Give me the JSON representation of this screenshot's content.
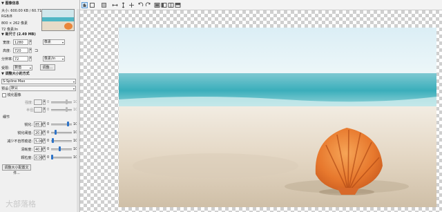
{
  "info": {
    "section_title": "图像信息",
    "size_line": "大小: 600.00 KB / 60.71 KB",
    "color_mode": "RGB/8",
    "dimensions": "800 × 262 像素",
    "resolution_line": "72 像素/in"
  },
  "new_size": {
    "section_title": "新尺寸 (2.49 MB)",
    "width_label": "宽度:",
    "width_value": "1280",
    "height_label": "高度:",
    "height_value": "720",
    "unit": "像素",
    "res_label": "分辨率:",
    "res_value": "72",
    "res_unit": "像素/in",
    "fit_label": "受限:",
    "fit_value": "数值",
    "adjust_button": "调整..."
  },
  "resample": {
    "section_title": "调整大小的方式",
    "method": "S-Spline Max",
    "preset_label": "预设:",
    "preset_value": "默认"
  },
  "sharpen": {
    "checkbox_label": "锐化图像",
    "strength_label": "强度:",
    "strength_value": "0",
    "radius_label": "半径:",
    "radius_value": "0",
    "max": "100"
  },
  "details": {
    "section_title": "细节",
    "rows": [
      {
        "label": "锐化:",
        "value": "85.00",
        "min": "0",
        "max": "100",
        "fraction": 0.85
      },
      {
        "label": "锐化阈值:",
        "value": "20.00",
        "min": "0",
        "max": "100",
        "fraction": 0.2
      },
      {
        "label": "减少不自然痕迹:",
        "value": "5.00",
        "min": "0",
        "max": "100",
        "fraction": 0.05
      },
      {
        "label": "清晰度:",
        "value": "40.00",
        "min": "0",
        "max": "100",
        "fraction": 0.4
      },
      {
        "label": "颗粒度:",
        "value": "0.00",
        "min": "0",
        "max": "100",
        "fraction": 0.0
      }
    ]
  },
  "footer_button": "调整大小配置文件...",
  "watermark": "大部落格",
  "colors": {
    "accent": "#2d73c8",
    "panel": "#f0f0f0"
  }
}
